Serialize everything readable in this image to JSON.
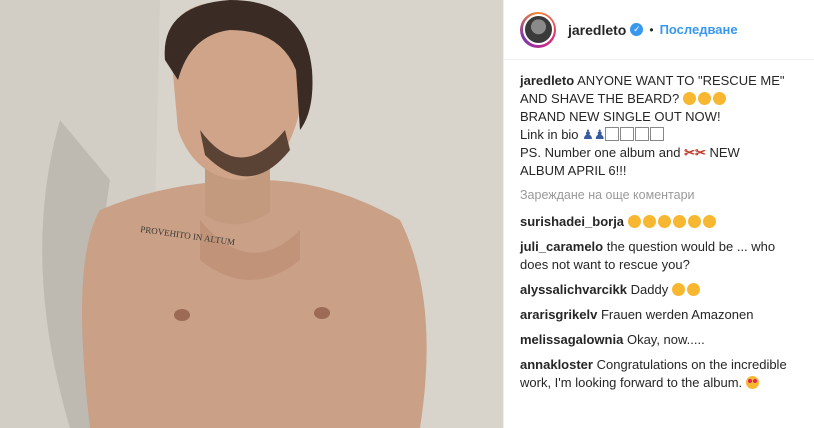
{
  "post": {
    "username": "jaredleto",
    "follow_label": "Последване",
    "separator": "•",
    "verified_glyph": "✓"
  },
  "photo": {
    "tattoo_text": "PROVEHITO IN ALTUM"
  },
  "caption": {
    "username": "jaredleto",
    "line1": "ANYONE WANT TO \"RESCUE ME\"",
    "line2": "AND SHAVE THE BEARD?",
    "line3": "BRAND NEW SINGLE OUT NOW!",
    "line4": "Link in bio",
    "line5": "PS. Number one album and",
    "line5b": "NEW",
    "line6": "ALBUM APRIL 6!!!"
  },
  "load_more": "Зареждане на още коментари",
  "comments": [
    {
      "user": "surishadei_borja",
      "text": ""
    },
    {
      "user": "juli_caramelo",
      "text": "the question would be ... who does not want to rescue you?"
    },
    {
      "user": "alyssalichvarcikk",
      "text": "Daddy"
    },
    {
      "user": "ararisgrikelv",
      "text": "Frauen werden Amazonen"
    },
    {
      "user": "melissagalownia",
      "text": "Okay, now....."
    },
    {
      "user": "annakloster",
      "text": "Congratulations on the incredible work, I'm looking forward to the album."
    }
  ],
  "colors": {
    "link_blue": "#3897f0",
    "muted": "#999999"
  },
  "icons": {
    "verified": "verified-badge-icon",
    "emoji": "smiling-face-icon"
  }
}
